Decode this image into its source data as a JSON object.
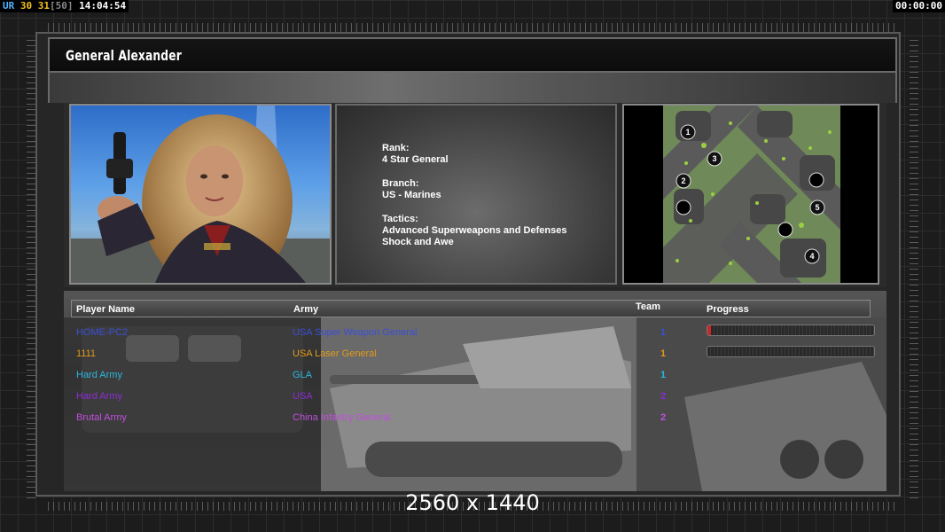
{
  "hud": {
    "ur": "UR",
    "fps_a": "30",
    "fps_b": "31",
    "fps_limit": "[50]",
    "clock": "14:04:54",
    "timer": "00:00:00"
  },
  "general": {
    "title": "General Alexander"
  },
  "stats": {
    "rank_label": "Rank:",
    "rank_value": "4 Star General",
    "branch_label": "Branch:",
    "branch_value": "US - Marines",
    "tactics_label": "Tactics:",
    "tactics_line1": "Advanced Superweapons and Defenses",
    "tactics_line2": "Shock and Awe"
  },
  "map": {
    "start_positions": [
      "1",
      "2",
      "3",
      "4",
      "5"
    ]
  },
  "table": {
    "headers": {
      "player": "Player Name",
      "army": "Army",
      "team": "Team",
      "progress": "Progress"
    },
    "rows": [
      {
        "player": "HOME-PC2",
        "army": "USA Super Weapon General",
        "team": "1",
        "color": "#3b4fd8",
        "progress": 0.02
      },
      {
        "player": "1111",
        "army": "USA Laser General",
        "team": "1",
        "color": "#e39a1a",
        "progress": 0.0
      },
      {
        "player": "Hard Army",
        "army": "GLA",
        "team": "1",
        "color": "#29b8e0",
        "progress": null
      },
      {
        "player": "Hard Army",
        "army": "USA",
        "team": "2",
        "color": "#8e2bd6",
        "progress": null
      },
      {
        "player": "Brutal Army",
        "army": "China Infantry General",
        "team": "2",
        "color": "#c24ee0",
        "progress": null
      }
    ]
  },
  "watermark": "2560 x 1440"
}
